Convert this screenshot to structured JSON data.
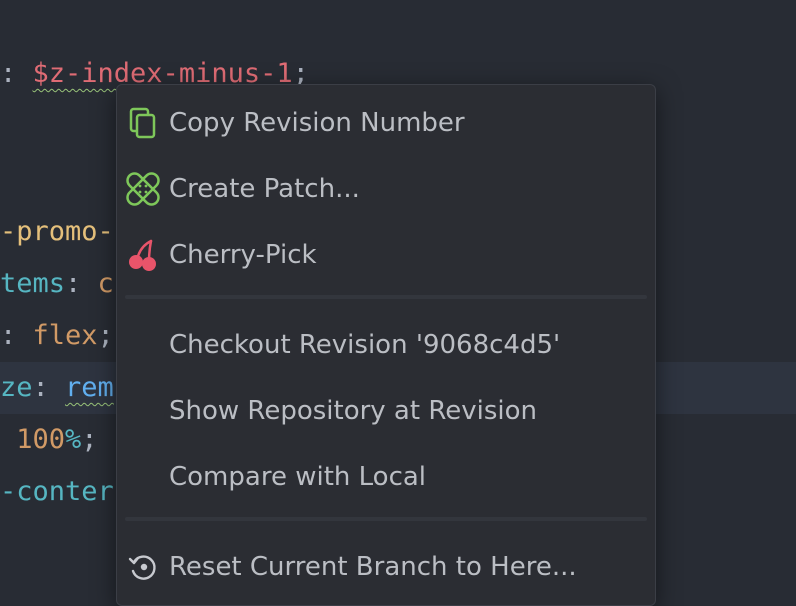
{
  "editor": {
    "lines": [
      {
        "parts": [
          {
            "t": ": ",
            "c": "punc"
          },
          {
            "t": "$z-index-minus-1",
            "c": "var",
            "sq": true
          },
          {
            "t": ";",
            "c": "punc"
          }
        ]
      },
      {
        "parts": []
      },
      {
        "parts": []
      },
      {
        "parts": [
          {
            "t": "-promo-",
            "c": "sel"
          }
        ]
      },
      {
        "parts": [
          {
            "t": "tems",
            "c": "prop"
          },
          {
            "t": ": ",
            "c": "punc"
          },
          {
            "t": "c",
            "c": "val"
          }
        ]
      },
      {
        "parts": [
          {
            "t": ": ",
            "c": "punc"
          },
          {
            "t": "flex",
            "c": "val"
          },
          {
            "t": ";",
            "c": "punc"
          }
        ]
      },
      {
        "parts": [
          {
            "t": "ze",
            "c": "prop"
          },
          {
            "t": ": ",
            "c": "punc"
          },
          {
            "t": "rem",
            "c": "fn",
            "sq": true
          }
        ]
      },
      {
        "parts": [
          {
            "t": " 100",
            "c": "num"
          },
          {
            "t": "%",
            "c": "prop"
          },
          {
            "t": ";",
            "c": "punc"
          }
        ]
      },
      {
        "parts": [
          {
            "t": "-conter",
            "c": "prop"
          }
        ]
      }
    ]
  },
  "menu": {
    "items": [
      {
        "label": "Copy Revision Number",
        "icon": "copy-icon",
        "name": "menu-item-copy-revision-number"
      },
      {
        "label": "Create Patch...",
        "icon": "patch-icon",
        "name": "menu-item-create-patch"
      },
      {
        "label": "Cherry-Pick",
        "icon": "cherry-icon",
        "name": "menu-item-cherry-pick"
      },
      {
        "label": "Checkout Revision '9068c4d5'",
        "icon": "",
        "name": "menu-item-checkout-revision"
      },
      {
        "label": "Show Repository at Revision",
        "icon": "",
        "name": "menu-item-show-repository"
      },
      {
        "label": "Compare with Local",
        "icon": "",
        "name": "menu-item-compare-with-local"
      },
      {
        "label": "Reset Current Branch to Here...",
        "icon": "reset-icon",
        "name": "menu-item-reset-branch"
      }
    ]
  },
  "colors": {
    "editor_bg": "#282c34",
    "menu_bg": "#2b2d33",
    "menu_text": "#bbbec4",
    "copy_icon": "#7ec75a",
    "patch_icon": "#7ec75a",
    "cherry_icon": "#e8546a",
    "reset_icon": "#c7c9cf"
  }
}
